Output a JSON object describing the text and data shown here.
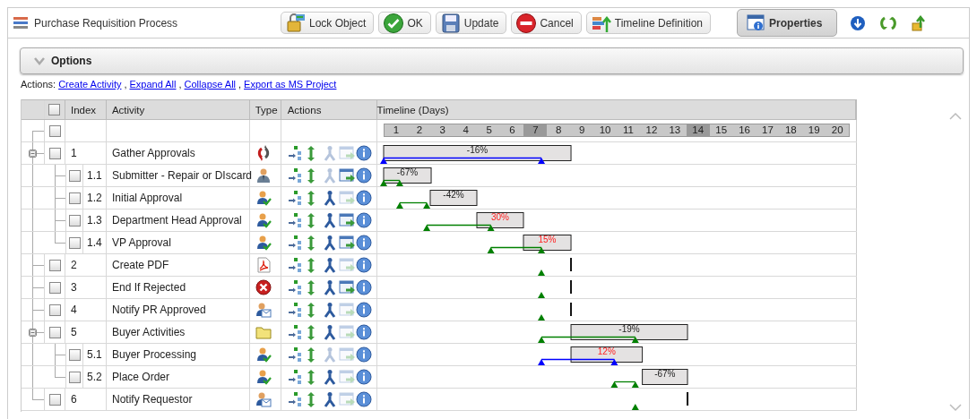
{
  "window": {
    "title": "Purchase Requisition Process"
  },
  "toolbar": {
    "buttons": [
      {
        "kind": "lock",
        "label": "Lock Object",
        "pressed": false
      },
      {
        "kind": "ok",
        "label": "OK",
        "pressed": false
      },
      {
        "kind": "save",
        "label": "Update",
        "pressed": false
      },
      {
        "kind": "cancel",
        "label": "Cancel",
        "pressed": false
      },
      {
        "kind": "timeline",
        "label": "Timeline Definition",
        "pressed": false
      },
      {
        "kind": "properties",
        "label": "Properties",
        "pressed": true
      }
    ],
    "icons": [
      {
        "kind": "down"
      },
      {
        "kind": "refresh"
      },
      {
        "kind": "upload"
      }
    ]
  },
  "options": {
    "label": "Options",
    "expanded": false
  },
  "actions_bar": {
    "label": "Actions:",
    "separator": ",",
    "links": [
      "Create Activity",
      "Expand All",
      "Collapse All",
      "Export as MS Project"
    ]
  },
  "table": {
    "columns": [
      "Index",
      "Activity",
      "Type",
      "Actions",
      "Timeline (Days)"
    ],
    "select_all": {
      "checked": false
    },
    "blank_row": {
      "checked": false
    },
    "days": [
      {
        "label": "1",
        "highlighted": false
      },
      {
        "label": "2",
        "highlighted": false
      },
      {
        "label": "3",
        "highlighted": false
      },
      {
        "label": "4",
        "highlighted": false
      },
      {
        "label": "5",
        "highlighted": false
      },
      {
        "label": "6",
        "highlighted": false
      },
      {
        "label": "7",
        "highlighted": true
      },
      {
        "label": "8",
        "highlighted": false
      },
      {
        "label": "9",
        "highlighted": false
      },
      {
        "label": "10",
        "highlighted": false
      },
      {
        "label": "11",
        "highlighted": false
      },
      {
        "label": "12",
        "highlighted": false
      },
      {
        "label": "13",
        "highlighted": false
      },
      {
        "label": "14",
        "highlighted": true
      },
      {
        "label": "15",
        "highlighted": false
      },
      {
        "label": "16",
        "highlighted": false
      },
      {
        "label": "17",
        "highlighted": false
      },
      {
        "label": "18",
        "highlighted": false
      },
      {
        "label": "19",
        "highlighted": false
      },
      {
        "label": "20",
        "highlighted": false
      }
    ],
    "rows": [
      {
        "index": "1",
        "activity": "Gather Approvals",
        "kind": "cycle",
        "checked": false,
        "expanded": true,
        "actions": [
          {
            "kind": "insert",
            "disabled": false
          },
          {
            "kind": "move",
            "disabled": false
          },
          {
            "kind": "branch",
            "disabled": true
          },
          {
            "kind": "window",
            "disabled": true
          },
          {
            "kind": "info",
            "disabled": false
          }
        ],
        "timeline": {
          "bar": {
            "label": "-16%",
            "late": false
          },
          "track": {
            "color": "#0000ff"
          }
        },
        "children": [
          {
            "index": "1.1",
            "activity": "Submitter - Repair or DIscard",
            "kind": "person",
            "checked": false,
            "actions": [
              {
                "kind": "insert",
                "disabled": false
              },
              {
                "kind": "move",
                "disabled": false
              },
              {
                "kind": "branch",
                "disabled": true
              },
              {
                "kind": "window",
                "disabled": false
              },
              {
                "kind": "info",
                "disabled": false
              }
            ],
            "timeline": {
              "bar": {
                "label": "-67%",
                "late": false
              },
              "track": {
                "color": "#008000"
              }
            }
          },
          {
            "index": "1.2",
            "activity": "Initial Approval",
            "kind": "person-check",
            "checked": false,
            "actions": [
              {
                "kind": "insert",
                "disabled": false
              },
              {
                "kind": "move",
                "disabled": false
              },
              {
                "kind": "branch",
                "disabled": false
              },
              {
                "kind": "window",
                "disabled": true
              },
              {
                "kind": "info",
                "disabled": false
              }
            ],
            "timeline": {
              "bar": {
                "label": "-42%",
                "late": false
              },
              "track": {
                "color": "#008000"
              }
            }
          },
          {
            "index": "1.3",
            "activity": "Department Head Approval",
            "kind": "person-check",
            "checked": false,
            "actions": [
              {
                "kind": "insert",
                "disabled": false
              },
              {
                "kind": "move",
                "disabled": false
              },
              {
                "kind": "branch",
                "disabled": false
              },
              {
                "kind": "window",
                "disabled": false
              },
              {
                "kind": "info",
                "disabled": false
              }
            ],
            "timeline": {
              "bar": {
                "label": "30%",
                "late": true
              },
              "track": {
                "color": "#008000"
              }
            }
          },
          {
            "index": "1.4",
            "activity": "VP Approval",
            "kind": "person-check",
            "checked": false,
            "actions": [
              {
                "kind": "insert",
                "disabled": false
              },
              {
                "kind": "move",
                "disabled": false
              },
              {
                "kind": "branch",
                "disabled": false
              },
              {
                "kind": "window",
                "disabled": false
              },
              {
                "kind": "info",
                "disabled": false
              }
            ],
            "timeline": {
              "bar": {
                "label": "15%",
                "late": true
              },
              "track": {
                "color": "#008000"
              }
            }
          }
        ]
      },
      {
        "index": "2",
        "activity": "Create PDF",
        "kind": "pdf",
        "checked": false,
        "actions": [
          {
            "kind": "insert",
            "disabled": false
          },
          {
            "kind": "move",
            "disabled": false
          },
          {
            "kind": "branch",
            "disabled": false
          },
          {
            "kind": "window",
            "disabled": true
          },
          {
            "kind": "info",
            "disabled": false
          }
        ],
        "timeline": {
          "kind": "milestone"
        }
      },
      {
        "index": "3",
        "activity": "End If Rejected",
        "kind": "stop",
        "checked": false,
        "actions": [
          {
            "kind": "insert",
            "disabled": false
          },
          {
            "kind": "move",
            "disabled": false
          },
          {
            "kind": "branch",
            "disabled": false
          },
          {
            "kind": "window",
            "disabled": false
          },
          {
            "kind": "info",
            "disabled": false
          }
        ],
        "timeline": {
          "kind": "milestone"
        }
      },
      {
        "index": "4",
        "activity": "Notify PR Approved",
        "kind": "mail",
        "checked": false,
        "actions": [
          {
            "kind": "insert",
            "disabled": false
          },
          {
            "kind": "move",
            "disabled": false
          },
          {
            "kind": "branch",
            "disabled": false
          },
          {
            "kind": "window",
            "disabled": true
          },
          {
            "kind": "info",
            "disabled": false
          }
        ],
        "timeline": {
          "kind": "milestone"
        }
      },
      {
        "index": "5",
        "activity": "Buyer Activities",
        "kind": "folder",
        "checked": false,
        "expanded": true,
        "actions": [
          {
            "kind": "insert",
            "disabled": false
          },
          {
            "kind": "move",
            "disabled": false
          },
          {
            "kind": "branch",
            "disabled": false
          },
          {
            "kind": "window",
            "disabled": true
          },
          {
            "kind": "info",
            "disabled": false
          }
        ],
        "timeline": {
          "bar": {
            "label": "-19%",
            "late": false
          },
          "track": {
            "color": "#008000"
          }
        },
        "children": [
          {
            "index": "5.1",
            "activity": "Buyer Processing",
            "kind": "person-check",
            "checked": false,
            "actions": [
              {
                "kind": "insert",
                "disabled": false
              },
              {
                "kind": "move",
                "disabled": false
              },
              {
                "kind": "branch",
                "disabled": true
              },
              {
                "kind": "window",
                "disabled": true
              },
              {
                "kind": "info",
                "disabled": false
              }
            ],
            "timeline": {
              "bar": {
                "label": "12%",
                "late": true
              },
              "track": {
                "color": "#0000ff"
              }
            }
          },
          {
            "index": "5.2",
            "activity": "Place Order",
            "kind": "person-check",
            "checked": false,
            "actions": [
              {
                "kind": "insert",
                "disabled": false
              },
              {
                "kind": "move",
                "disabled": false
              },
              {
                "kind": "branch",
                "disabled": false
              },
              {
                "kind": "window",
                "disabled": true
              },
              {
                "kind": "info",
                "disabled": false
              }
            ],
            "timeline": {
              "bar": {
                "label": "-67%",
                "late": false
              },
              "track": {
                "color": "#008000"
              }
            }
          }
        ]
      },
      {
        "index": "6",
        "activity": "Notify Requestor",
        "kind": "mail",
        "checked": false,
        "actions": [
          {
            "kind": "insert",
            "disabled": false
          },
          {
            "kind": "move",
            "disabled": false
          },
          {
            "kind": "branch",
            "disabled": false
          },
          {
            "kind": "window",
            "disabled": true
          },
          {
            "kind": "info",
            "disabled": false
          }
        ],
        "timeline": {
          "kind": "milestone"
        }
      }
    ]
  }
}
